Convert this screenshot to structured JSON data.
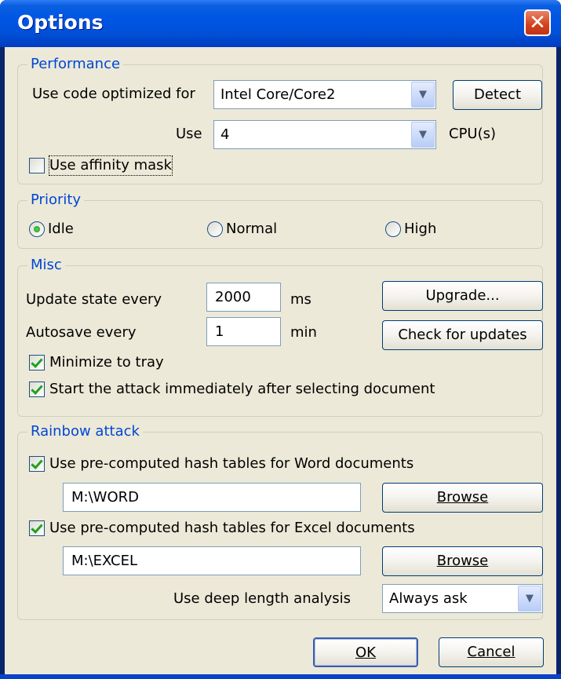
{
  "window": {
    "title": "Options",
    "close_glyph": "✕"
  },
  "performance": {
    "legend": "Performance",
    "optimized_label": "Use code optimized for",
    "optimized_value": "Intel Core/Core2",
    "detect_button": "Detect",
    "use_label": "Use",
    "cpu_value": "4",
    "cpu_suffix": "CPU(s)",
    "affinity_label": "Use affinity mask",
    "affinity_checked": false
  },
  "priority": {
    "legend": "Priority",
    "options": [
      {
        "label": "Idle",
        "selected": true
      },
      {
        "label": "Normal",
        "selected": false
      },
      {
        "label": "High",
        "selected": false
      }
    ]
  },
  "misc": {
    "legend": "Misc",
    "update_label": "Update state every",
    "update_value": "2000",
    "update_unit": "ms",
    "autosave_label": "Autosave every",
    "autosave_value": "1",
    "autosave_unit": "min",
    "upgrade_button": "Upgrade...",
    "check_updates_button": "Check for updates",
    "minimize_label": "Minimize to tray",
    "minimize_checked": true,
    "start_attack_label": "Start the attack immediately after selecting document",
    "start_attack_checked": true
  },
  "rainbow": {
    "legend": "Rainbow attack",
    "word_label": "Use pre-computed hash tables for Word documents",
    "word_checked": true,
    "word_path": "M:\\WORD",
    "excel_label": "Use pre-computed hash tables for Excel documents",
    "excel_checked": true,
    "excel_path": "M:\\EXCEL",
    "browse_button": "Browse",
    "deep_label": "Use deep length analysis",
    "deep_value": "Always ask"
  },
  "footer": {
    "ok_button": "OK",
    "cancel_button": "Cancel"
  },
  "icons": {
    "dropdown": "chevron-down-icon",
    "close": "close-icon"
  },
  "colors": {
    "titlebar": "#0055e5",
    "legend": "#0046d5",
    "dialog_bg": "#ece9d8",
    "check_mark": "#21a121"
  }
}
